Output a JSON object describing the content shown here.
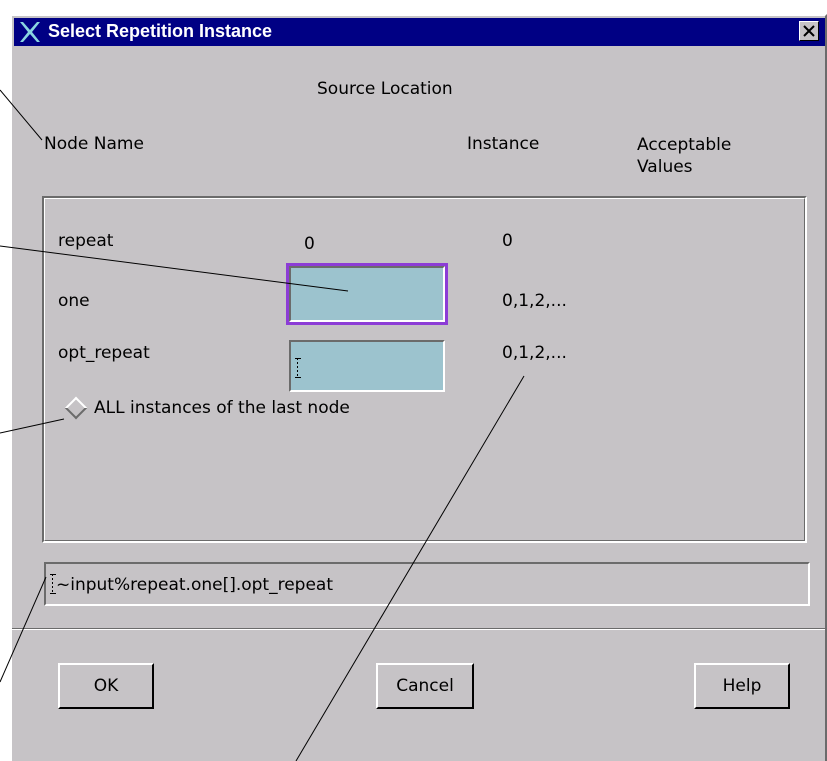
{
  "window": {
    "title": "Select Repetition Instance",
    "close_symbol": "×",
    "app_icon": "x-logo-icon"
  },
  "header": {
    "source_location": "Source Location",
    "node_name": "Node Name",
    "instance": "Instance",
    "acceptable_line1": "Acceptable",
    "acceptable_line2": "Values"
  },
  "rows": [
    {
      "name": "repeat",
      "instance": "0",
      "acceptable": "0"
    },
    {
      "name": "one",
      "instance": "",
      "acceptable": "0,1,2,..."
    },
    {
      "name": "opt_repeat",
      "instance": "",
      "acceptable": "0,1,2,..."
    }
  ],
  "all_instances": {
    "label": "ALL instances of the last node",
    "checked": false
  },
  "selection_path": "~input%repeat.one[].opt_repeat",
  "buttons": {
    "ok": "OK",
    "cancel": "Cancel",
    "help": "Help"
  },
  "colors": {
    "title_bar": "#000084",
    "window_bg": "#c6c3c6",
    "entry_bg": "#9cc3ce",
    "focus_ring": "#8c3cd6"
  }
}
